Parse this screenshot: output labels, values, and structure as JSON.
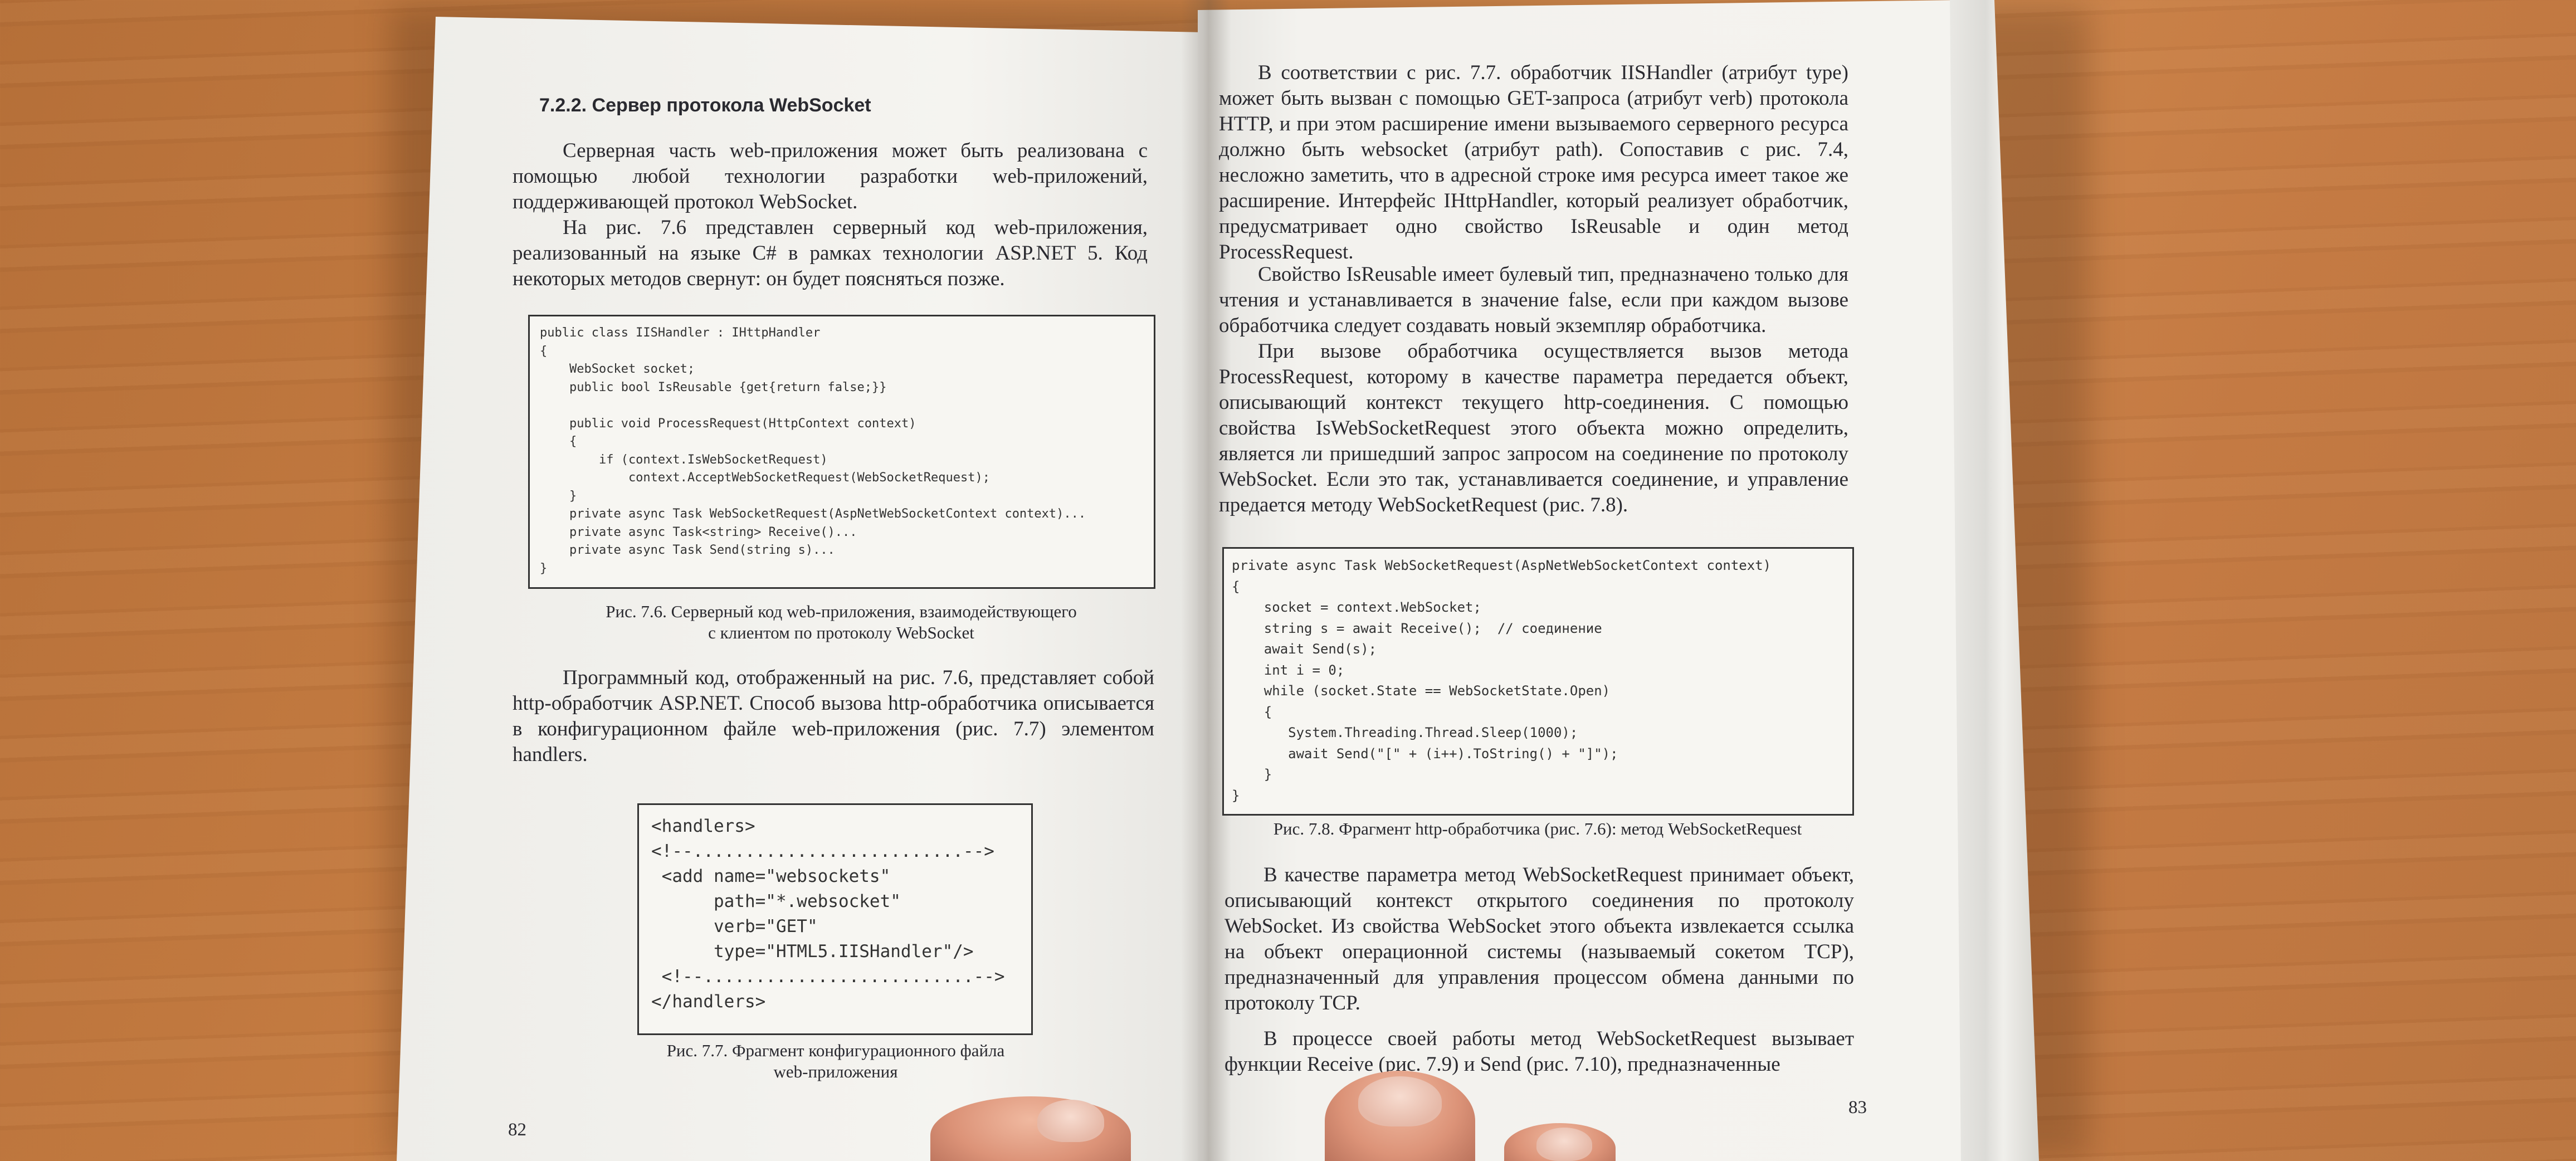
{
  "left_page": {
    "heading": "7.2.2. Сервер протокола WebSocket",
    "paragraphs": [
      "Серверная часть web-приложения может быть реализована с помощью любой технологии разработки web-приложений, поддерживающей протокол WebSocket.",
      "На рис. 7.6 представлен серверный код web-приложения, реализованный на языке C# в рамках технологии ASP.NET 5. Код некоторых методов свернут: он будет поясняться позже."
    ],
    "code_7_6": "public class IISHandler : IHttpHandler\n{\n    WebSocket socket;\n    public bool IsReusable {get{return false;}}\n\n    public void ProcessRequest(HttpContext context)\n    {\n        if (context.IsWebSocketRequest)\n            context.AcceptWebSocketRequest(WebSocketRequest);\n    }\n    private async Task WebSocketRequest(AspNetWebSocketContext context)...\n    private async Task<string> Receive()...\n    private async Task Send(string s)...\n}",
    "caption_7_6_line1": "Рис. 7.6. Серверный код web-приложения, взаимодействующего",
    "caption_7_6_line2": "с клиентом по протоколу WebSocket",
    "paragraph_after": "Программный код, отображенный на рис. 7.6, представляет собой http-обработчик ASP.NET. Способ вызова http-обработчика описывается в конфигурационном файле web-приложения (рис. 7.7) элементом handlers.",
    "code_7_7": "<handlers>\n<!--..........................-->\n <add name=\"websockets\"\n      path=\"*.websocket\"\n      verb=\"GET\"\n      type=\"HTML5.IISHandler\"/>\n <!--..........................-->\n</handlers>",
    "caption_7_7_line1": "Рис. 7.7. Фрагмент конфигурационного файла",
    "caption_7_7_line2": "web-приложения",
    "page_number": "82"
  },
  "right_page": {
    "paragraphs_top": [
      "В соответствии с рис. 7.7. обработчик IISHandler (атрибут type) может быть вызван с помощью GET-запроса (атрибут verb) протокола HTTP, и при этом расширение имени вызываемого серверного ресурса должно быть websocket (атрибут path). Сопоставив с рис. 7.4, несложно заметить, что в адресной строке имя ресурса имеет такое же расширение. Интерфейс IHttpHandler, который реализует обработчик, предусматривает одно свойство IsReusable и один метод ProcessRequest.",
      "Свойство IsReusable имеет булевый тип, предназначено только для чтения и устанавливается в значение false, если при каждом вызове обработчика следует создавать новый экземпляр обработчика.",
      "При вызове обработчика осуществляется вызов метода ProcessRequest, которому в качестве параметра передается объект, описывающий контекст текущего http-соединения. С помощью свойства IsWebSocketRequest этого объекта можно определить, является ли пришедший запрос запросом на соединение по протоколу WebSocket. Если это так, устанавливается соединение, и управление предается методу WebSocketRequest (рис. 7.8)."
    ],
    "code_7_8": "private async Task WebSocketRequest(AspNetWebSocketContext context)\n{\n    socket = context.WebSocket;\n    string s = await Receive();  // соединение\n    await Send(s);\n    int i = 0;\n    while (socket.State == WebSocketState.Open)\n    {\n       System.Threading.Thread.Sleep(1000);\n       await Send(\"[\" + (i++).ToString() + \"]\");\n    }\n}",
    "caption_7_8": "Рис. 7.8. Фрагмент http-обработчика (рис. 7.6): метод WebSocketRequest",
    "paragraphs_bottom": [
      "В качестве параметра метод WebSocketRequest принимает объект, описывающий контекст открытого соединения по протоколу WebSocket. Из свойства WebSocket этого объекта извлекается ссылка на объект операционной системы (называемый сокетом TCP), предназначенный для управления процессом обмена данными по протоколу TCP.",
      "В процессе своей работы метод WebSocketRequest вызывает функции Receive (рис. 7.9) и Send (рис. 7.10), предназначенные"
    ],
    "page_number": "83"
  }
}
